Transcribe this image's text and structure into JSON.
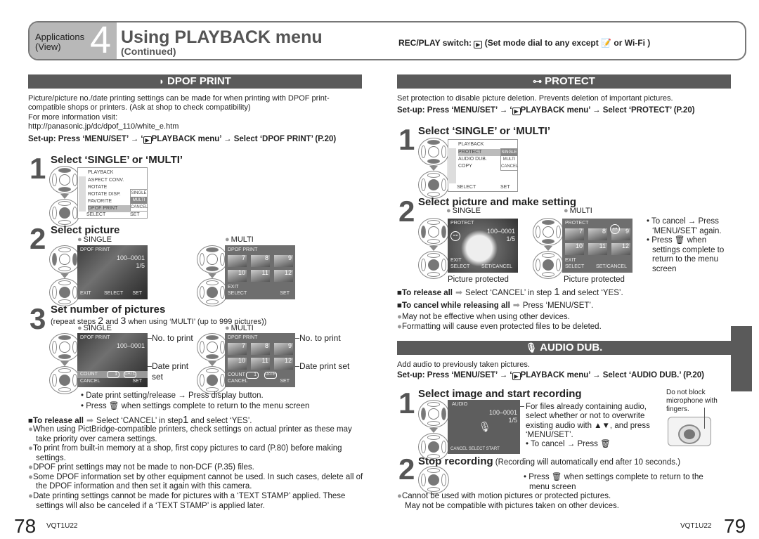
{
  "header": {
    "section": "Applications",
    "section_sub": "(View)",
    "chapter_num": "4",
    "title": "Using PLAYBACK menu",
    "subtitle": "(Continued)",
    "rec_play": "REC/PLAY switch:",
    "rec_play_rest": "(Set mode dial to any except",
    "rec_play_end": "or Wi-Fi )"
  },
  "dpof": {
    "banner": "DPOF PRINT",
    "intro": "Picture/picture no./date printing settings can be made for when printing with DPOF print-compatible shops or printers. (Ask at shop to check compatibility)",
    "more_info": "For more information visit:",
    "url": "http://panasonic.jp/dc/dpof_110/white_e.htm",
    "setup_a": "Set-up: Press ‘MENU/SET’ → ‘",
    "setup_b": "PLAYBACK menu’ → Select ‘DPOF PRINT’ (P.20)",
    "step1": {
      "num": "1",
      "title": "Select ‘SINGLE’ or ‘MULTI’",
      "menu_title": "PLAYBACK",
      "menu_items": [
        "ASPECT CONV.",
        "ROTATE",
        "ROTATE DISP.",
        "FAVORITE",
        "DPOF PRINT"
      ],
      "options": [
        "SINGLE",
        "MULTI",
        "CANCEL"
      ],
      "footer_left": "SELECT",
      "footer_right": "SET"
    },
    "step2": {
      "num": "2",
      "title": "Select picture",
      "single_label": "SINGLE",
      "multi_label": "MULTI",
      "single_screen": {
        "top": "DPOF PRINT",
        "file": "100–0001",
        "count": "1/5",
        "exit": "EXIT",
        "select": "SELECT",
        "set": "SET"
      },
      "multi_screen": {
        "top": "DPOF PRINT",
        "thumbs": [
          "7",
          "8",
          "9",
          "10",
          "11",
          "12"
        ],
        "exit": "EXIT",
        "select": "SELECT",
        "set": "SET"
      }
    },
    "step3": {
      "num": "3",
      "title": "Set number of pictures",
      "sub_a": "(repeat steps",
      "sub_2": "2",
      "sub_and": "and",
      "sub_3": "3",
      "sub_b": "when using ‘MULTI’ (up to 999 pictures))",
      "single_label": "SINGLE",
      "multi_label": "MULTI",
      "no_to_print": "No. to print",
      "date_print_set_single": "Date print set",
      "date_print_set_multi": "Date print set",
      "count_label": "COUNT",
      "count_value": "1",
      "date_label": "DATE",
      "cancel_label": "CANCEL",
      "set_label": "SET",
      "tips": [
        "• Date print setting/release → Press display button.",
        "• Press 🗑 when settings complete to return to the menu screen"
      ]
    },
    "release_all": {
      "label": "To release all",
      "text_a": "Select ‘CANCEL’ in step",
      "step": "1",
      "text_b": "and select ‘YES’."
    },
    "notes": [
      "When using PictBridge-compatible printers, check settings on actual printer as these may take priority over camera settings.",
      "To print from built-in memory at a shop, first copy pictures to card (P.80) before making settings.",
      "DPOF print settings may not be made to non-DCF (P.35) files.",
      "Some DPOF information set by other equipment cannot be used. In such cases, delete all of the DPOF information and then set it again with this camera.",
      "Date printing settings cannot be made for pictures with a ‘TEXT STAMP’ applied. These settings will also be canceled if a ‘TEXT STAMP’ is applied later."
    ]
  },
  "protect": {
    "banner": "PROTECT",
    "intro": "Set protection to disable picture deletion. Prevents deletion of important pictures.",
    "setup_a": "Set-up: Press ‘MENU/SET’ → ‘",
    "setup_b": "PLAYBACK menu’ → Select ‘PROTECT’ (P.20)",
    "step1": {
      "num": "1",
      "title": "Select ‘SINGLE’ or ‘MULTI’",
      "menu_title": "PLAYBACK",
      "menu_items": [
        "PROTECT",
        "AUDIO DUB.",
        "COPY"
      ],
      "options": [
        "SINGLE",
        "MULTI",
        "CANCEL"
      ],
      "footer_left": "SELECT",
      "footer_right": "SET"
    },
    "step2": {
      "num": "2",
      "title": "Select picture and make setting",
      "single_label": "SINGLE",
      "multi_label": "MULTI",
      "single_screen": {
        "top": "PROTECT",
        "file": "100–0001",
        "count": "1/5",
        "exit": "EXIT",
        "select": "SELECT",
        "set": "SET/CANCEL"
      },
      "multi_screen": {
        "top": "PROTECT",
        "thumbs": [
          "7",
          "8",
          "9",
          "10",
          "11",
          "12"
        ],
        "exit": "EXIT",
        "select": "SELECT",
        "set": "SET/CANCEL"
      },
      "picture_protected": "Picture protected",
      "tips": [
        "• To cancel → Press ‘MENU/SET’ again.",
        "• Press 🗑 when settings complete to return to the menu screen"
      ]
    },
    "release_all": {
      "label": "To release all",
      "text_a": "Select ‘CANCEL’ in step",
      "step": "1",
      "text_b": "and select ‘YES’."
    },
    "cancel_release": {
      "label": "To cancel while releasing all",
      "text": "Press ‘MENU/SET’."
    },
    "notes": [
      "May not be effective when using other devices.",
      "Formatting will cause even protected files to be deleted."
    ]
  },
  "audio_dub": {
    "banner": "AUDIO DUB.",
    "intro": "Add audio to previously taken pictures.",
    "setup_a": "Set-up: Press ‘MENU/SET’ → ‘",
    "setup_b": "PLAYBACK menu’ → Select ‘AUDIO DUB.’ (P.20)",
    "step1": {
      "num": "1",
      "title": "Select image and start recording",
      "screen": {
        "top": "AUDIO",
        "file": "100–0001",
        "count": "1/5",
        "footer": "CANCEL  SELECT  START"
      },
      "desc": "For files already containing audio, select whether or not to overwrite existing audio with ▲▼, and press ‘MENU/SET’.",
      "cancel_tip": "• To cancel → Press 🗑",
      "camera_note": "Do not block microphone with fingers."
    },
    "step2": {
      "num": "2",
      "title": "Stop recording",
      "title_note": "(Recording will automatically end after 10 seconds.)",
      "tip": "• Press 🗑 when settings complete to return to the menu screen"
    },
    "notes": [
      "Cannot be used with motion pictures or protected pictures.",
      "May not be compatible with pictures taken on other devices."
    ]
  },
  "footer": {
    "left_page": "78",
    "right_page": "79",
    "code": "VQT1U22"
  }
}
